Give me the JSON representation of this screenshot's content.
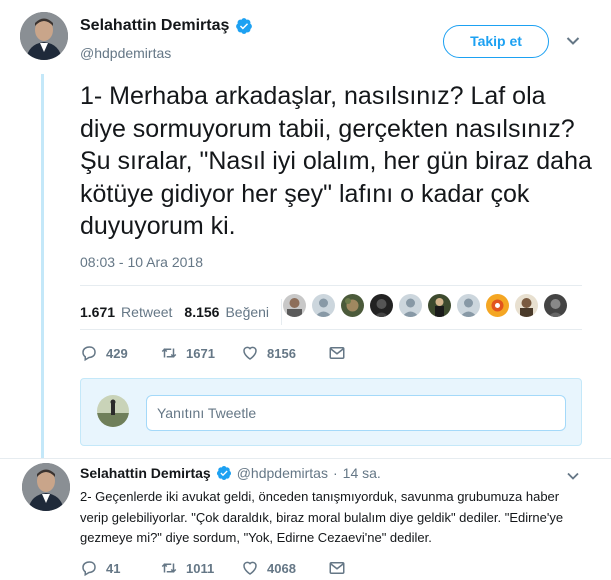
{
  "main_tweet": {
    "display_name": "Selahattin Demirtaş",
    "handle": "@hdpdemirtas",
    "follow_label": "Takip et",
    "text": "1- Merhaba arkadaşlar, nasılsınız? Laf ola diye sormuyorum tabii, gerçekten nasılsınız? Şu sıralar, \"Nasıl iyi olalım, her gün biraz daha kötüye gidiyor her şey\" lafını o kadar çok duyuyorum ki.",
    "timestamp": "08:03 - 10 Ara 2018",
    "stats": {
      "retweets": "1.671",
      "retweets_label": "Retweet",
      "likes": "8.156",
      "likes_label": "Beğeni"
    },
    "actions": {
      "reply_count": "429",
      "retweet_count": "1671",
      "like_count": "8156"
    }
  },
  "reply_box": {
    "placeholder": "Yanıtını Tweetle"
  },
  "second_tweet": {
    "display_name": "Selahattin Demirtaş",
    "handle": "@hdpdemirtas",
    "dot": "·",
    "time": "14 sa.",
    "text": "2- Geçenlerde iki avukat geldi, önceden tanışmıyorduk, savunma grubumuza haber verip gelebiliyorlar. \"Çok daraldık, biraz moral bulalım diye geldik\" dediler. \"Edirne'ye gezmeye mi?\" diye sordum, \"Yok, Edirne Cezaevi'ne\" dediler.",
    "actions": {
      "reply_count": "41",
      "retweet_count": "1011",
      "like_count": "4068"
    }
  },
  "colors": {
    "accent": "#1da1f2",
    "muted": "#657786",
    "thread_line": "#c4e8f9",
    "reply_box_bg": "#e8f5fd"
  },
  "icons": [
    "verified-badge-icon",
    "chevron-down-icon",
    "reply-icon",
    "retweet-icon",
    "heart-icon",
    "message-icon"
  ]
}
